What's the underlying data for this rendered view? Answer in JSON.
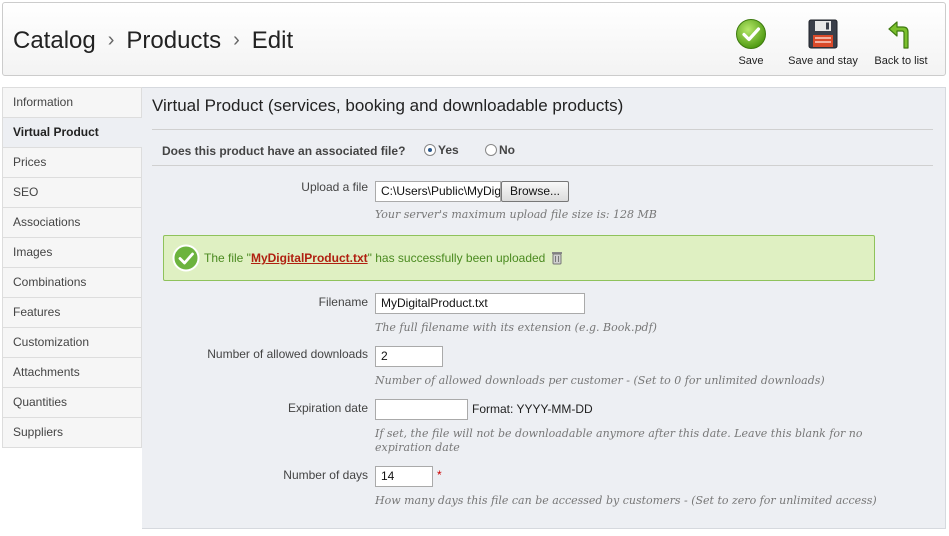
{
  "breadcrumb": [
    "Catalog",
    "Products",
    "Edit"
  ],
  "toolbar": {
    "save": {
      "label": "Save",
      "icon": "check-circle-icon"
    },
    "save_stay": {
      "label": "Save and stay",
      "icon": "floppy-disk-icon"
    },
    "back": {
      "label": "Back to list",
      "icon": "back-arrow-icon"
    }
  },
  "sidebar": {
    "items": [
      {
        "label": "Information"
      },
      {
        "label": "Virtual Product",
        "active": true
      },
      {
        "label": "Prices"
      },
      {
        "label": "SEO"
      },
      {
        "label": "Associations"
      },
      {
        "label": "Images"
      },
      {
        "label": "Combinations"
      },
      {
        "label": "Features"
      },
      {
        "label": "Customization"
      },
      {
        "label": "Attachments"
      },
      {
        "label": "Quantities"
      },
      {
        "label": "Suppliers"
      }
    ]
  },
  "main": {
    "title": "Virtual Product (services, booking and downloadable products)",
    "question": "Does this product have an associated file?",
    "radio_yes": "Yes",
    "radio_no": "No",
    "radio_selected": "Yes",
    "upload": {
      "label": "Upload a file",
      "value": "C:\\Users\\Public\\MyDig",
      "browse": "Browse...",
      "hint": "Your server's maximum upload file size is: 128 MB"
    },
    "success": {
      "prefix": "The file \"",
      "filename": "MyDigitalProduct.txt",
      "suffix": "\" has successfully been uploaded"
    },
    "filename": {
      "label": "Filename",
      "value": "MyDigitalProduct.txt",
      "hint": "The full filename with its extension (e.g. Book.pdf)"
    },
    "downloads": {
      "label": "Number of allowed downloads",
      "value": "2",
      "hint": "Number of allowed downloads per customer - (Set to 0 for unlimited downloads)"
    },
    "expiration": {
      "label": "Expiration date",
      "value": "",
      "format": "Format: YYYY-MM-DD",
      "hint_line1": "If set, the file will not be downloadable anymore after this date. Leave this blank for no",
      "hint_line2": "expiration date"
    },
    "days": {
      "label": "Number of days",
      "value": "14",
      "required": "*",
      "hint": "How many days this file can be accessed by customers - (Set to zero for unlimited access)"
    }
  },
  "colors": {
    "panel_bg": "#edeff3",
    "success_bg": "#dff0c2",
    "success_text": "#4a8a1f",
    "link_red": "#b02010",
    "required_red": "#cc0000"
  }
}
